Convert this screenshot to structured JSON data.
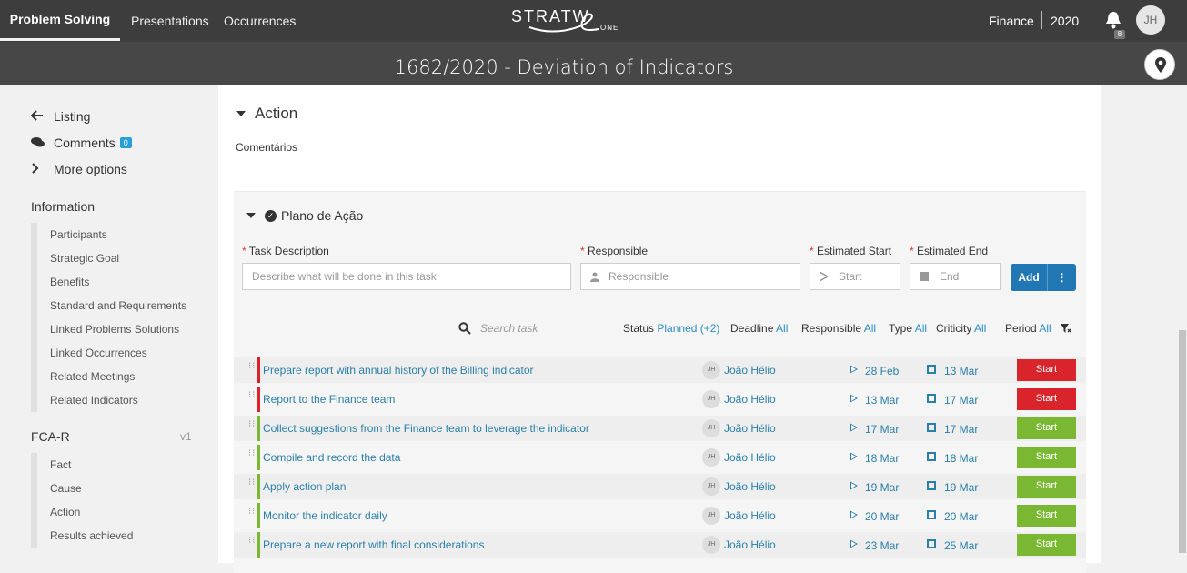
{
  "topbar": {
    "nav": [
      "Problem Solving",
      "Presentations",
      "Occurrences"
    ],
    "logo_text": "STRATW",
    "logo_sub": "ONE",
    "area": "Finance",
    "year": "2020",
    "notifications": "8",
    "user_initials": "JH"
  },
  "page_title": "1682/2020 - Deviation of Indicators",
  "sidebar": {
    "links": [
      {
        "icon": "arrow-left-icon",
        "label": "Listing"
      },
      {
        "icon": "comments-icon",
        "label": "Comments",
        "count": "0"
      },
      {
        "icon": "chevron-right-icon",
        "label": "More options"
      }
    ],
    "information_title": "Information",
    "information_items": [
      "Participants",
      "Strategic Goal",
      "Benefits",
      "Standard and Requirements",
      "Linked Problems Solutions",
      "Linked Occurrences",
      "Related Meetings",
      "Related Indicators"
    ],
    "fcar_title": "FCA-R",
    "fcar_version": "v1",
    "fcar_items": [
      "Fact",
      "Cause",
      "Action",
      "Results achieved"
    ]
  },
  "main": {
    "section_title": "Action",
    "comments_label": "Comentários",
    "plan_title": "Plano de Ação",
    "form": {
      "required_mark": "*",
      "task_label": "Task Description",
      "task_placeholder": "Describe what will be done in this task",
      "responsible_label": "Responsible",
      "responsible_placeholder": "Responsible",
      "start_label": "Estimated Start",
      "start_placeholder": "Start",
      "end_label": "Estimated End",
      "end_placeholder": "End",
      "add_label": "Add"
    },
    "search_placeholder": "Search task",
    "filters": [
      {
        "label": "Status",
        "value": "Planned (+2)"
      },
      {
        "label": "Deadline",
        "value": "All"
      },
      {
        "label": "Responsible",
        "value": "All"
      },
      {
        "label": "Type",
        "value": "All"
      },
      {
        "label": "Criticity",
        "value": "All"
      },
      {
        "label": "Period",
        "value": "All"
      }
    ],
    "tasks": [
      {
        "task": "Prepare report with annual history of the Billing indicator",
        "initials": "JH",
        "responsible": "João Hélio",
        "start": "28 Feb",
        "end": "13 Mar",
        "action": "Start",
        "color": "#d9242b"
      },
      {
        "task": "Report to the Finance team",
        "initials": "JH",
        "responsible": "João Hélio",
        "start": "13 Mar",
        "end": "17 Mar",
        "action": "Start",
        "color": "#d9242b"
      },
      {
        "task": "Collect suggestions from the Finance team to leverage the indicator",
        "initials": "JH",
        "responsible": "João Hélio",
        "start": "17 Mar",
        "end": "17 Mar",
        "action": "Start",
        "color": "#7ab833"
      },
      {
        "task": "Compile and record the data",
        "initials": "JH",
        "responsible": "João Hélio",
        "start": "18 Mar",
        "end": "18 Mar",
        "action": "Start",
        "color": "#7ab833"
      },
      {
        "task": "Apply action plan",
        "initials": "JH",
        "responsible": "João Hélio",
        "start": "19 Mar",
        "end": "19 Mar",
        "action": "Start",
        "color": "#7ab833"
      },
      {
        "task": "Monitor the indicator daily",
        "initials": "JH",
        "responsible": "João Hélio",
        "start": "20 Mar",
        "end": "20 Mar",
        "action": "Start",
        "color": "#7ab833"
      },
      {
        "task": "Prepare a new report with final considerations",
        "initials": "JH",
        "responsible": "João Hélio",
        "start": "23 Mar",
        "end": "25 Mar",
        "action": "Start",
        "color": "#7ab833"
      }
    ]
  }
}
